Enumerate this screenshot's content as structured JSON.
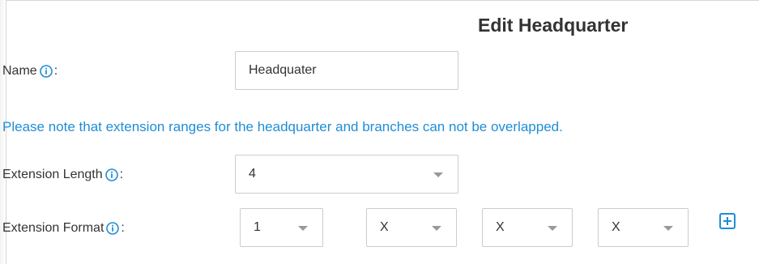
{
  "form": {
    "title": "Edit Headquarter",
    "name": {
      "label": "Name",
      "colon": ":",
      "value": "Headquater"
    },
    "note": "Please note that extension ranges for the headquarter and branches can not be overlapped.",
    "extension_length": {
      "label": "Extension Length",
      "colon": ":",
      "selected": "4"
    },
    "extension_format": {
      "label": "Extension Format",
      "colon": ":",
      "digits": [
        "1",
        "X",
        "X",
        "X"
      ]
    }
  },
  "icons": {
    "info": "info-circle-icon",
    "add": "plus-square-icon",
    "caret": "chevron-down-icon"
  },
  "colors": {
    "accent": "#1f8dd6",
    "text": "#333333",
    "border": "#cccccc"
  }
}
